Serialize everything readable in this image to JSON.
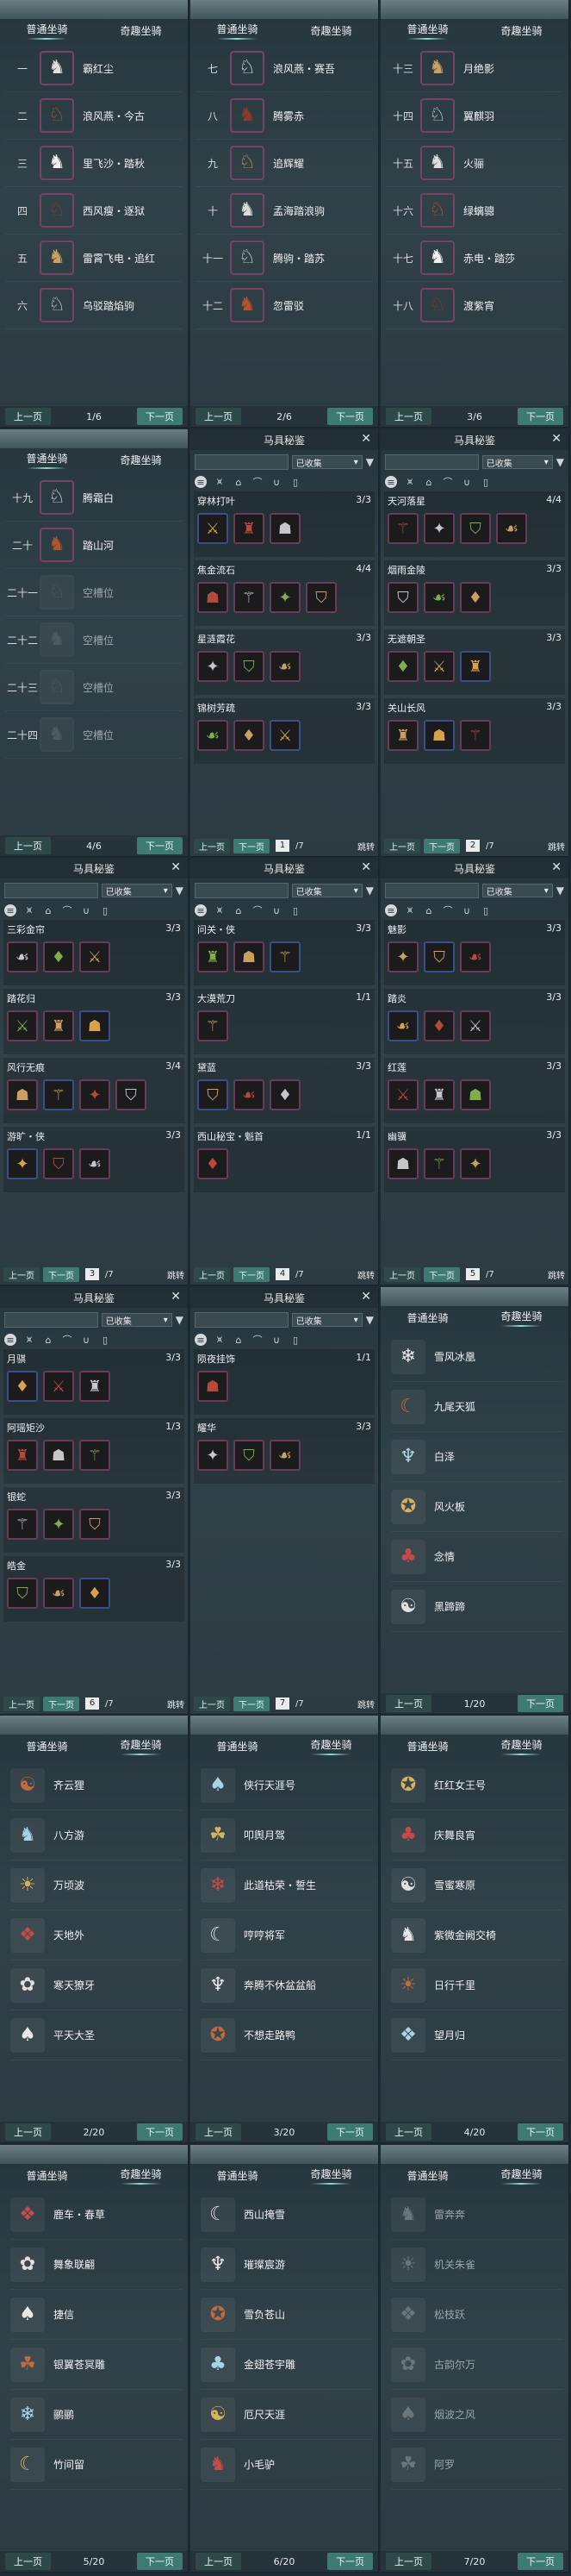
{
  "tabs": {
    "normal": "普通坐骑",
    "exotic": "奇趣坐骑"
  },
  "buttons": {
    "prev": "上一页",
    "next": "下一页",
    "jump": "跳转"
  },
  "modal": {
    "title": "马具秘鉴",
    "filter": "已收集"
  },
  "normal_pages": [
    {
      "page": "1/6",
      "rows": [
        [
          "一",
          "霸红尘"
        ],
        [
          "二",
          "浪风燕・今古"
        ],
        [
          "三",
          "里飞沙・踏秋"
        ],
        [
          "四",
          "西风瘦・逐狱"
        ],
        [
          "五",
          "雷霄飞电・追红"
        ],
        [
          "六",
          "乌驳踏焰驹"
        ]
      ]
    },
    {
      "page": "2/6",
      "rows": [
        [
          "七",
          "浪风燕・赛吾"
        ],
        [
          "八",
          "腾雾赤"
        ],
        [
          "九",
          "追辉耀"
        ],
        [
          "十",
          "孟海踏浪驹"
        ],
        [
          "十一",
          "腾驹・踏苏"
        ],
        [
          "十二",
          "忽雷驳"
        ]
      ]
    },
    {
      "page": "3/6",
      "rows": [
        [
          "十三",
          "月绝影"
        ],
        [
          "十四",
          "翼麒羽"
        ],
        [
          "十五",
          "火骊"
        ],
        [
          "十六",
          "绿螭骢"
        ],
        [
          "十七",
          "赤电・踏莎"
        ],
        [
          "十八",
          "渡紫宵"
        ]
      ]
    },
    {
      "page": "4/6",
      "rows": [
        [
          "十九",
          "腾霜白"
        ],
        [
          "二十",
          "踏山河"
        ],
        [
          "二十一",
          "空槽位"
        ],
        [
          "二十二",
          "空槽位"
        ],
        [
          "二十三",
          "空槽位"
        ],
        [
          "二十四",
          "空槽位"
        ]
      ]
    }
  ],
  "sets_pages": [
    {
      "page": "1",
      "total": "/7",
      "sets": [
        [
          "穿林打叶",
          "3/3"
        ],
        [
          "焦金流石",
          "4/4"
        ],
        [
          "星涟霞花",
          "3/3"
        ],
        [
          "锦树芳疏",
          "3/3"
        ]
      ]
    },
    {
      "page": "2",
      "total": "/7",
      "sets": [
        [
          "天河落星",
          "4/4"
        ],
        [
          "烟雨金陵",
          "3/3"
        ],
        [
          "无遮朝圣",
          "3/3"
        ],
        [
          "关山长风",
          "3/3"
        ]
      ]
    },
    {
      "page": "3",
      "total": "/7",
      "sets": [
        [
          "三彩金帘",
          "3/3"
        ],
        [
          "踏花归",
          "3/3"
        ],
        [
          "风行无痕",
          "3/4"
        ],
        [
          "游旷・侠",
          "3/3"
        ]
      ]
    },
    {
      "page": "4",
      "total": "/7",
      "sets": [
        [
          "问关・侠",
          "3/3"
        ],
        [
          "大漠荒刀",
          "1/1"
        ],
        [
          "黛蓝",
          "3/3"
        ],
        [
          "西山秘宝・魁首",
          "1/1"
        ]
      ]
    },
    {
      "page": "5",
      "total": "/7",
      "sets": [
        [
          "魅影",
          "3/3"
        ],
        [
          "踏炎",
          "3/3"
        ],
        [
          "红莲",
          "3/3"
        ],
        [
          "幽骥",
          "3/3"
        ]
      ]
    },
    {
      "page": "6",
      "total": "/7",
      "sets": [
        [
          "月骐",
          "3/3"
        ],
        [
          "阿瑶矩沙",
          "1/3"
        ],
        [
          "银蛇",
          "3/3"
        ],
        [
          "皓金",
          "3/3"
        ]
      ]
    },
    {
      "page": "7",
      "total": "/7",
      "sets": [
        [
          "陨夜挂饰",
          "1/1"
        ],
        [
          "耀华",
          "3/3"
        ]
      ]
    }
  ],
  "exotic_pages": [
    {
      "page": "1/20",
      "rows": [
        "雪风冰凰",
        "九尾天狐",
        "白泽",
        "风火板",
        "念情",
        "黑蹄蹄"
      ]
    },
    {
      "page": "2/20",
      "rows": [
        "齐云狸",
        "八方游",
        "万顷波",
        "天地外",
        "寒天獠牙",
        "平天大圣"
      ]
    },
    {
      "page": "3/20",
      "rows": [
        "侠行天涯号",
        "叩舆月驾",
        "此道枯荣・誓生",
        "哼哼将军",
        "奔腾不休盆盆船",
        "不想走路鸭"
      ]
    },
    {
      "page": "4/20",
      "rows": [
        "红红女王号",
        "庆舞良宵",
        "雪蜜寒原",
        "紫微金阙交椅",
        "日行千里",
        "望月归"
      ]
    },
    {
      "page": "5/20",
      "rows": [
        "鹿车・春草",
        "舞象联翩",
        "捷信",
        "银翼苍冥雕",
        "鹂鹂",
        "竹间留"
      ]
    },
    {
      "page": "6/20",
      "rows": [
        "西山掩雪",
        "璀璨宸游",
        "雪负苍山",
        "金翅苍宇雕",
        "厄尺天涯",
        "小毛驴"
      ]
    },
    {
      "page": "7/20",
      "rows": [
        "雷奔奔",
        "机关朱雀",
        "松枝跃",
        "古韵尔万",
        "烟波之风",
        "阿罗"
      ]
    }
  ]
}
